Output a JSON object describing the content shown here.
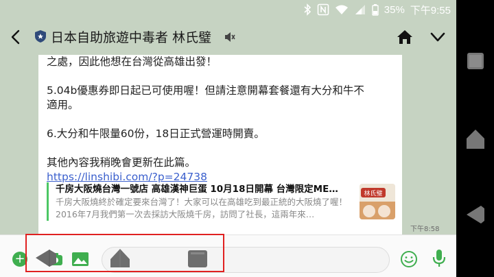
{
  "status": {
    "battery": "35%",
    "time": "下午9:55"
  },
  "header": {
    "title": "日本自助旅遊中毒者 林氏璧",
    "icons": [
      "back-arrow",
      "shield-badge",
      "muted-speaker",
      "home",
      "chevron-down"
    ]
  },
  "message": {
    "lines": [
      "之處，因此他想在台灣從高雄出發！",
      "",
      "5.04b優惠券即日起已可使用喔！但請注意開幕套餐還有大分和牛不",
      "適用。",
      "",
      "6.大分和牛限量60份，18日正式營運時開賣。",
      "",
      "其他內容我稍晚會更新在此篇。"
    ],
    "link": "https://linshibi.com/?p=24738",
    "preview": {
      "title": "千房大阪燒台灣一號店 高雄漢神巨蛋 10月18日開幕 台灣限定ME…",
      "description": "千房大阪燒終於確定要來台灣了！大家可以在高雄吃到最正統的大阪燒了喔！ 2016年7月我們第一次去採訪大阪燒千房，訪問了社長，這兩年來…",
      "thumb_text": "林氏璧"
    },
    "time": "下午8:58"
  },
  "input": {
    "placeholder": "",
    "icons": [
      "plus",
      "camera",
      "image",
      "emoji",
      "mic"
    ]
  },
  "colors": {
    "chat_bg": "#c6d3c2",
    "line_green": "#3fae4f",
    "link": "#3a5fcd",
    "highlight": "#e02020"
  }
}
